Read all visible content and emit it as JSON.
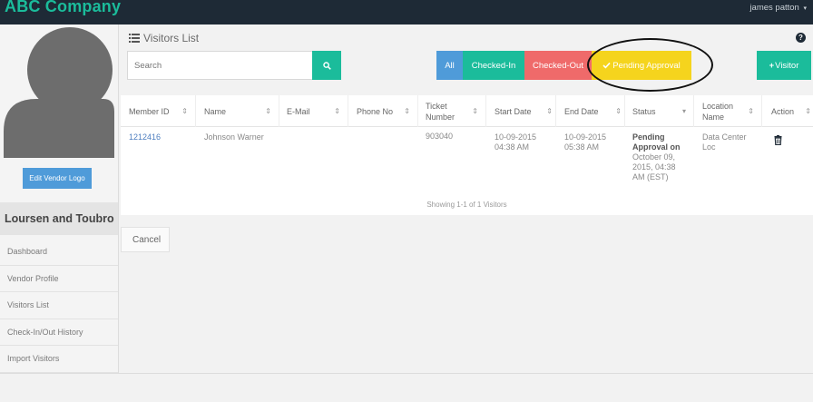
{
  "header": {
    "brand": "ABC Company",
    "user": "james patton",
    "user_caret": "▾"
  },
  "sidebar": {
    "edit_logo": "Edit Vendor Logo",
    "company": "Loursen and Toubro",
    "items": [
      {
        "label": "Dashboard"
      },
      {
        "label": "Vendor Profile"
      },
      {
        "label": "Visitors List"
      },
      {
        "label": "Check-In/Out History"
      },
      {
        "label": "Import Visitors"
      }
    ]
  },
  "main": {
    "title": "Visitors List",
    "help": "?",
    "search_placeholder": "Search",
    "filters": {
      "all": "All",
      "checked_in": "Checked-In",
      "checked_out": "Checked-Out",
      "pending": "Pending Approval"
    },
    "add_visitor": "Visitor",
    "table": {
      "columns": [
        "Member ID",
        "Name",
        "E-Mail",
        "Phone No",
        "Ticket Number",
        "Start Date",
        "End Date",
        "Status",
        "Location Name",
        "Action"
      ],
      "rows": [
        {
          "member_id": "1212416",
          "name": "Johnson Warner",
          "email": "",
          "phone": "",
          "ticket": "903040",
          "start_date": "10-09-2015 04:38 AM",
          "end_date": "10-09-2015 05:38 AM",
          "status_bold": "Pending Approval on",
          "status_detail": "October 09, 2015, 04:38 AM (EST)",
          "location": "Data Center Loc"
        }
      ],
      "showing": "Showing 1-1 of 1 Visitors"
    },
    "cancel": "Cancel"
  }
}
